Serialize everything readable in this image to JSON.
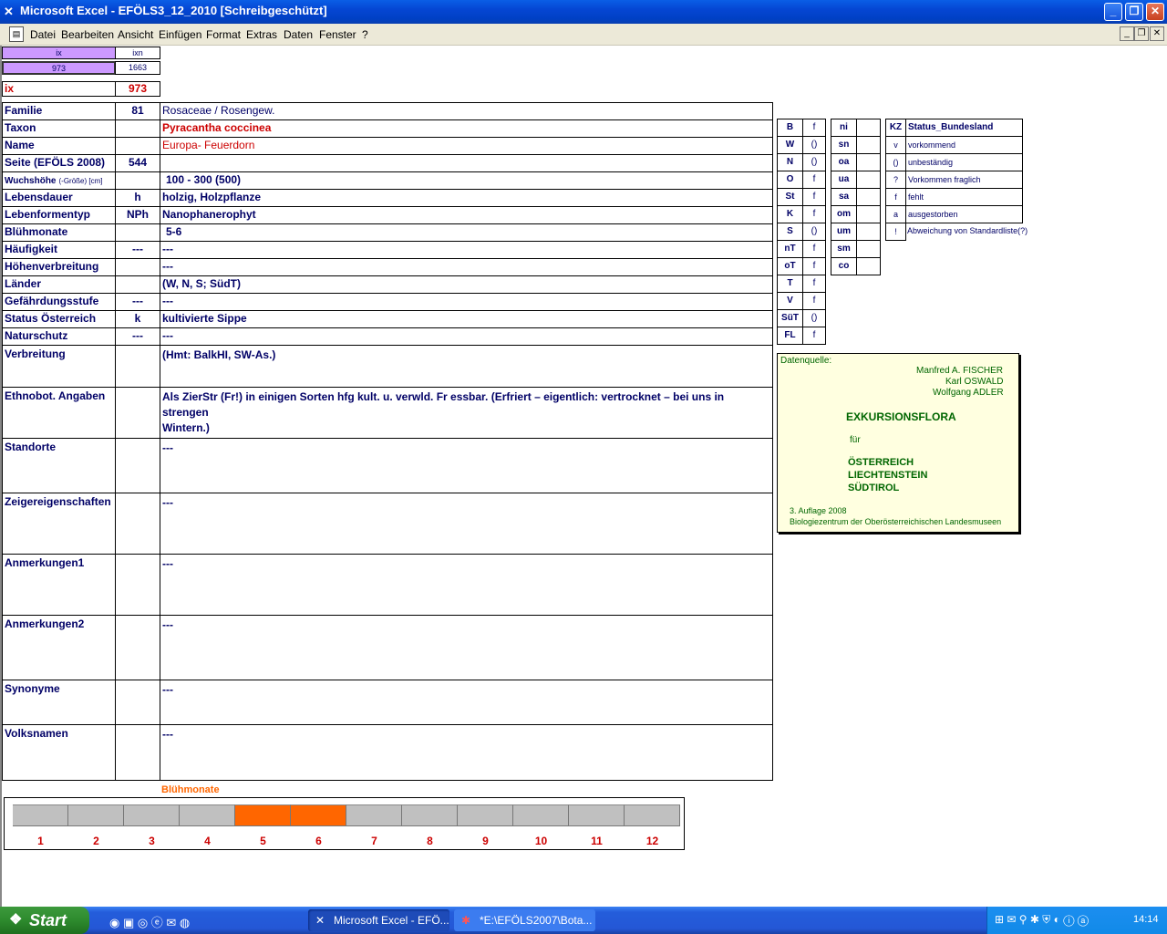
{
  "window": {
    "title": "Microsoft Excel - EFÖLS3_12_2010  [Schreibgeschützt]",
    "app_icon": "excel-icon"
  },
  "menu": [
    "Datei",
    "Bearbeiten",
    "Ansicht",
    "Einfügen",
    "Format",
    "Extras",
    "Daten",
    "Fenster",
    "?"
  ],
  "top_cells": {
    "ix_head": "ix",
    "ixn_head": "ixn",
    "ix_val": "973",
    "ixn_val": "1663",
    "ix_label": "ix",
    "ix_main": "973"
  },
  "rows": [
    {
      "label": "Familie",
      "code": "81",
      "value": "Rosaceae / Rosengew."
    },
    {
      "label": "Taxon",
      "code": "",
      "value": "Pyracantha coccinea"
    },
    {
      "label": "Name",
      "code": "",
      "value": "Europa- Feuerdorn"
    },
    {
      "label": "Seite (EFÖLS 2008)",
      "code": "544",
      "value": ""
    },
    {
      "label": "Wuchshöhe",
      "label_suffix": "(-Größe) [cm]",
      "code": "",
      "value": "100 - 300 (500)"
    },
    {
      "label": "Lebensdauer",
      "code": "h",
      "value": "holzig, Holzpflanze"
    },
    {
      "label": "Lebenformentyp",
      "code": "NPh",
      "value": "Nanophanerophyt"
    },
    {
      "label": "Blühmonate",
      "code": "",
      "value": "5-6"
    },
    {
      "label": "Häufigkeit",
      "code": "---",
      "value": "---"
    },
    {
      "label": "Höhenverbreitung",
      "code": "",
      "value": "---"
    },
    {
      "label": "Länder",
      "code": "",
      "value": "(W, N, S; SüdT)"
    },
    {
      "label": "Gefährdungsstufe",
      "code": "---",
      "value": "---"
    },
    {
      "label": "Status Österreich",
      "code": "k",
      "value": "kultivierte Sippe"
    },
    {
      "label": "Naturschutz",
      "code": "---",
      "value": "---"
    },
    {
      "label": "Verbreitung",
      "code": "",
      "value": "(Hmt: BalkHI, SW-As.)"
    },
    {
      "label": "Ethnobot. Angaben",
      "code": "",
      "value": "Als ZierStr (Fr!) in einigen Sorten hfg kult. u.  verwld. Fr essbar. (Erfriert – eigentlich: vertrocknet – bei uns in strengen",
      "value2": "Wintern.)"
    },
    {
      "label": "Standorte",
      "code": "",
      "value": "---"
    },
    {
      "label": "Zeigereigenschaften",
      "code": "",
      "value": "---"
    },
    {
      "label": "Anmerkungen1",
      "code": "",
      "value": "---"
    },
    {
      "label": "Anmerkungen2",
      "code": "",
      "value": "---"
    },
    {
      "label": "Synonyme",
      "code": "",
      "value": "---"
    },
    {
      "label": "Volksnamen",
      "code": "",
      "value": "---"
    }
  ],
  "regions": [
    {
      "k": "B",
      "v": "f"
    },
    {
      "k": "W",
      "v": "()"
    },
    {
      "k": "N",
      "v": "()"
    },
    {
      "k": "O",
      "v": "f"
    },
    {
      "k": "St",
      "v": "f"
    },
    {
      "k": "K",
      "v": "f"
    },
    {
      "k": "S",
      "v": "()"
    },
    {
      "k": "nT",
      "v": "f"
    },
    {
      "k": "oT",
      "v": "f"
    },
    {
      "k": "T",
      "v": "f"
    },
    {
      "k": "V",
      "v": "f"
    },
    {
      "k": "SüT",
      "v": "()"
    },
    {
      "k": "FL",
      "v": "f"
    }
  ],
  "altitude": [
    {
      "k": "ni",
      "v": ""
    },
    {
      "k": "sn",
      "v": ""
    },
    {
      "k": "oa",
      "v": ""
    },
    {
      "k": "ua",
      "v": ""
    },
    {
      "k": "sa",
      "v": ""
    },
    {
      "k": "om",
      "v": ""
    },
    {
      "k": "um",
      "v": ""
    },
    {
      "k": "sm",
      "v": ""
    },
    {
      "k": "co",
      "v": ""
    }
  ],
  "status_legend": {
    "head_kz": "KZ",
    "head_label": "Status_Bundesland",
    "items": [
      {
        "k": "v",
        "v": "vorkommend"
      },
      {
        "k": "()",
        "v": "unbeständig"
      },
      {
        "k": "?",
        "v": "Vorkommen fraglich"
      },
      {
        "k": "f",
        "v": "fehlt"
      },
      {
        "k": "a",
        "v": "ausgestorben"
      },
      {
        "k": "!",
        "v": "Abweichung von Standardliste(?)"
      }
    ]
  },
  "datenquelle": {
    "head": "Datenquelle:",
    "author1": "Manfred A. FISCHER",
    "author2": "Karl OSWALD",
    "author3": "Wolfgang ADLER",
    "title": "EXKURSIONSFLORA",
    "fuer": "für",
    "c1": "ÖSTERREICH",
    "c2": "LIECHTENSTEIN",
    "c3": "SÜDTIROL",
    "edition": "3. Auflage 2008",
    "publisher": "Biologiezentrum der Oberösterreichischen Landesmuseen"
  },
  "chart_data": {
    "type": "bar",
    "title": "Blühmonate",
    "categories": [
      "1",
      "2",
      "3",
      "4",
      "5",
      "6",
      "7",
      "8",
      "9",
      "10",
      "11",
      "12"
    ],
    "values": [
      0,
      0,
      0,
      0,
      1,
      1,
      0,
      0,
      0,
      0,
      0,
      0
    ],
    "colors": {
      "on": "#ff6600",
      "off": "#c0c0c0"
    }
  },
  "taskbar": {
    "start": "Start",
    "task1": "Microsoft Excel - EFÖ...",
    "task2": "*E:\\EFÖLS2007\\Bota...",
    "clock": "14:14"
  }
}
